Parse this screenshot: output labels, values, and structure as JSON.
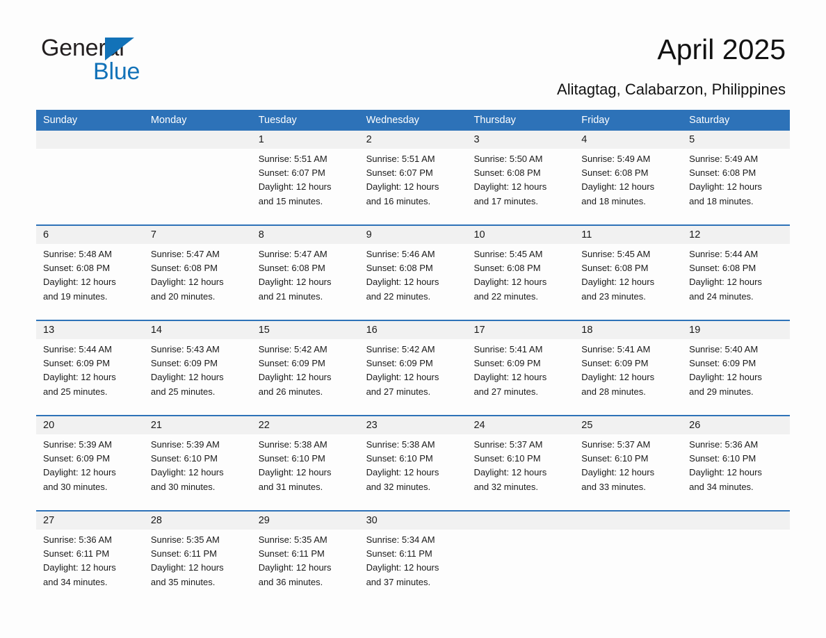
{
  "logo": {
    "line1": "General",
    "line2": "Blue",
    "triangle_color": "#1272b8"
  },
  "header": {
    "title": "April 2025",
    "subtitle": "Alitagtag, Calabarzon, Philippines",
    "accent_color": "#2d72b8"
  },
  "calendar": {
    "weekdays": [
      "Sunday",
      "Monday",
      "Tuesday",
      "Wednesday",
      "Thursday",
      "Friday",
      "Saturday"
    ],
    "weeks": [
      {
        "daynums": [
          "",
          "",
          "1",
          "2",
          "3",
          "4",
          "5"
        ],
        "cells": [
          {
            "lines": []
          },
          {
            "lines": []
          },
          {
            "lines": [
              "Sunrise: 5:51 AM",
              "Sunset: 6:07 PM",
              "Daylight: 12 hours",
              "and 15 minutes."
            ]
          },
          {
            "lines": [
              "Sunrise: 5:51 AM",
              "Sunset: 6:07 PM",
              "Daylight: 12 hours",
              "and 16 minutes."
            ]
          },
          {
            "lines": [
              "Sunrise: 5:50 AM",
              "Sunset: 6:08 PM",
              "Daylight: 12 hours",
              "and 17 minutes."
            ]
          },
          {
            "lines": [
              "Sunrise: 5:49 AM",
              "Sunset: 6:08 PM",
              "Daylight: 12 hours",
              "and 18 minutes."
            ]
          },
          {
            "lines": [
              "Sunrise: 5:49 AM",
              "Sunset: 6:08 PM",
              "Daylight: 12 hours",
              "and 18 minutes."
            ]
          }
        ]
      },
      {
        "daynums": [
          "6",
          "7",
          "8",
          "9",
          "10",
          "11",
          "12"
        ],
        "cells": [
          {
            "lines": [
              "Sunrise: 5:48 AM",
              "Sunset: 6:08 PM",
              "Daylight: 12 hours",
              "and 19 minutes."
            ]
          },
          {
            "lines": [
              "Sunrise: 5:47 AM",
              "Sunset: 6:08 PM",
              "Daylight: 12 hours",
              "and 20 minutes."
            ]
          },
          {
            "lines": [
              "Sunrise: 5:47 AM",
              "Sunset: 6:08 PM",
              "Daylight: 12 hours",
              "and 21 minutes."
            ]
          },
          {
            "lines": [
              "Sunrise: 5:46 AM",
              "Sunset: 6:08 PM",
              "Daylight: 12 hours",
              "and 22 minutes."
            ]
          },
          {
            "lines": [
              "Sunrise: 5:45 AM",
              "Sunset: 6:08 PM",
              "Daylight: 12 hours",
              "and 22 minutes."
            ]
          },
          {
            "lines": [
              "Sunrise: 5:45 AM",
              "Sunset: 6:08 PM",
              "Daylight: 12 hours",
              "and 23 minutes."
            ]
          },
          {
            "lines": [
              "Sunrise: 5:44 AM",
              "Sunset: 6:08 PM",
              "Daylight: 12 hours",
              "and 24 minutes."
            ]
          }
        ]
      },
      {
        "daynums": [
          "13",
          "14",
          "15",
          "16",
          "17",
          "18",
          "19"
        ],
        "cells": [
          {
            "lines": [
              "Sunrise: 5:44 AM",
              "Sunset: 6:09 PM",
              "Daylight: 12 hours",
              "and 25 minutes."
            ]
          },
          {
            "lines": [
              "Sunrise: 5:43 AM",
              "Sunset: 6:09 PM",
              "Daylight: 12 hours",
              "and 25 minutes."
            ]
          },
          {
            "lines": [
              "Sunrise: 5:42 AM",
              "Sunset: 6:09 PM",
              "Daylight: 12 hours",
              "and 26 minutes."
            ]
          },
          {
            "lines": [
              "Sunrise: 5:42 AM",
              "Sunset: 6:09 PM",
              "Daylight: 12 hours",
              "and 27 minutes."
            ]
          },
          {
            "lines": [
              "Sunrise: 5:41 AM",
              "Sunset: 6:09 PM",
              "Daylight: 12 hours",
              "and 27 minutes."
            ]
          },
          {
            "lines": [
              "Sunrise: 5:41 AM",
              "Sunset: 6:09 PM",
              "Daylight: 12 hours",
              "and 28 minutes."
            ]
          },
          {
            "lines": [
              "Sunrise: 5:40 AM",
              "Sunset: 6:09 PM",
              "Daylight: 12 hours",
              "and 29 minutes."
            ]
          }
        ]
      },
      {
        "daynums": [
          "20",
          "21",
          "22",
          "23",
          "24",
          "25",
          "26"
        ],
        "cells": [
          {
            "lines": [
              "Sunrise: 5:39 AM",
              "Sunset: 6:09 PM",
              "Daylight: 12 hours",
              "and 30 minutes."
            ]
          },
          {
            "lines": [
              "Sunrise: 5:39 AM",
              "Sunset: 6:10 PM",
              "Daylight: 12 hours",
              "and 30 minutes."
            ]
          },
          {
            "lines": [
              "Sunrise: 5:38 AM",
              "Sunset: 6:10 PM",
              "Daylight: 12 hours",
              "and 31 minutes."
            ]
          },
          {
            "lines": [
              "Sunrise: 5:38 AM",
              "Sunset: 6:10 PM",
              "Daylight: 12 hours",
              "and 32 minutes."
            ]
          },
          {
            "lines": [
              "Sunrise: 5:37 AM",
              "Sunset: 6:10 PM",
              "Daylight: 12 hours",
              "and 32 minutes."
            ]
          },
          {
            "lines": [
              "Sunrise: 5:37 AM",
              "Sunset: 6:10 PM",
              "Daylight: 12 hours",
              "and 33 minutes."
            ]
          },
          {
            "lines": [
              "Sunrise: 5:36 AM",
              "Sunset: 6:10 PM",
              "Daylight: 12 hours",
              "and 34 minutes."
            ]
          }
        ]
      },
      {
        "daynums": [
          "27",
          "28",
          "29",
          "30",
          "",
          "",
          ""
        ],
        "cells": [
          {
            "lines": [
              "Sunrise: 5:36 AM",
              "Sunset: 6:11 PM",
              "Daylight: 12 hours",
              "and 34 minutes."
            ]
          },
          {
            "lines": [
              "Sunrise: 5:35 AM",
              "Sunset: 6:11 PM",
              "Daylight: 12 hours",
              "and 35 minutes."
            ]
          },
          {
            "lines": [
              "Sunrise: 5:35 AM",
              "Sunset: 6:11 PM",
              "Daylight: 12 hours",
              "and 36 minutes."
            ]
          },
          {
            "lines": [
              "Sunrise: 5:34 AM",
              "Sunset: 6:11 PM",
              "Daylight: 12 hours",
              "and 37 minutes."
            ]
          },
          {
            "lines": []
          },
          {
            "lines": []
          },
          {
            "lines": []
          }
        ]
      }
    ]
  }
}
